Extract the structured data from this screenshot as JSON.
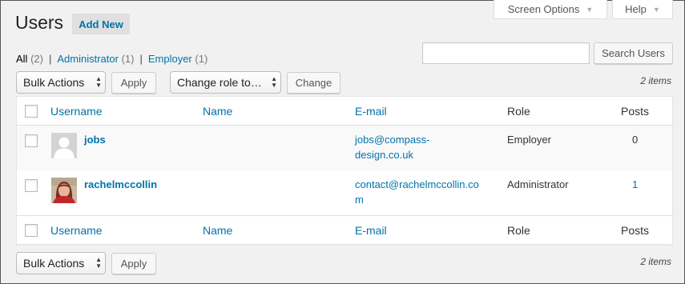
{
  "tabs": {
    "screen_options": "Screen Options",
    "help": "Help"
  },
  "header": {
    "title": "Users",
    "add_new": "Add New"
  },
  "filters": {
    "all_label": "All",
    "all_count": "(2)",
    "admin_label": "Administrator",
    "admin_count": "(1)",
    "employer_label": "Employer",
    "employer_count": "(1)",
    "separator": "|"
  },
  "search": {
    "value": "",
    "button": "Search Users"
  },
  "top_nav": {
    "bulk_actions": "Bulk Actions",
    "apply": "Apply",
    "change_role": "Change role to…",
    "change": "Change",
    "items": "2 items"
  },
  "bottom_nav": {
    "bulk_actions": "Bulk Actions",
    "apply": "Apply",
    "items": "2 items"
  },
  "columns": {
    "username": "Username",
    "name": "Name",
    "email": "E-mail",
    "role": "Role",
    "posts": "Posts"
  },
  "rows": [
    {
      "username": "jobs",
      "name": "",
      "email_line1": "jobs@compass-",
      "email_line2": "design.co.uk",
      "role": "Employer",
      "posts": "0",
      "avatar": "default-avatar"
    },
    {
      "username": "rachelmccollin",
      "name": "",
      "email_line1": "contact@rachelmccollin.co",
      "email_line2": "m",
      "role": "Administrator",
      "posts": "1",
      "avatar": "photo-avatar"
    }
  ],
  "colors": {
    "link": "#0073aa",
    "background": "#f1f1f1"
  }
}
